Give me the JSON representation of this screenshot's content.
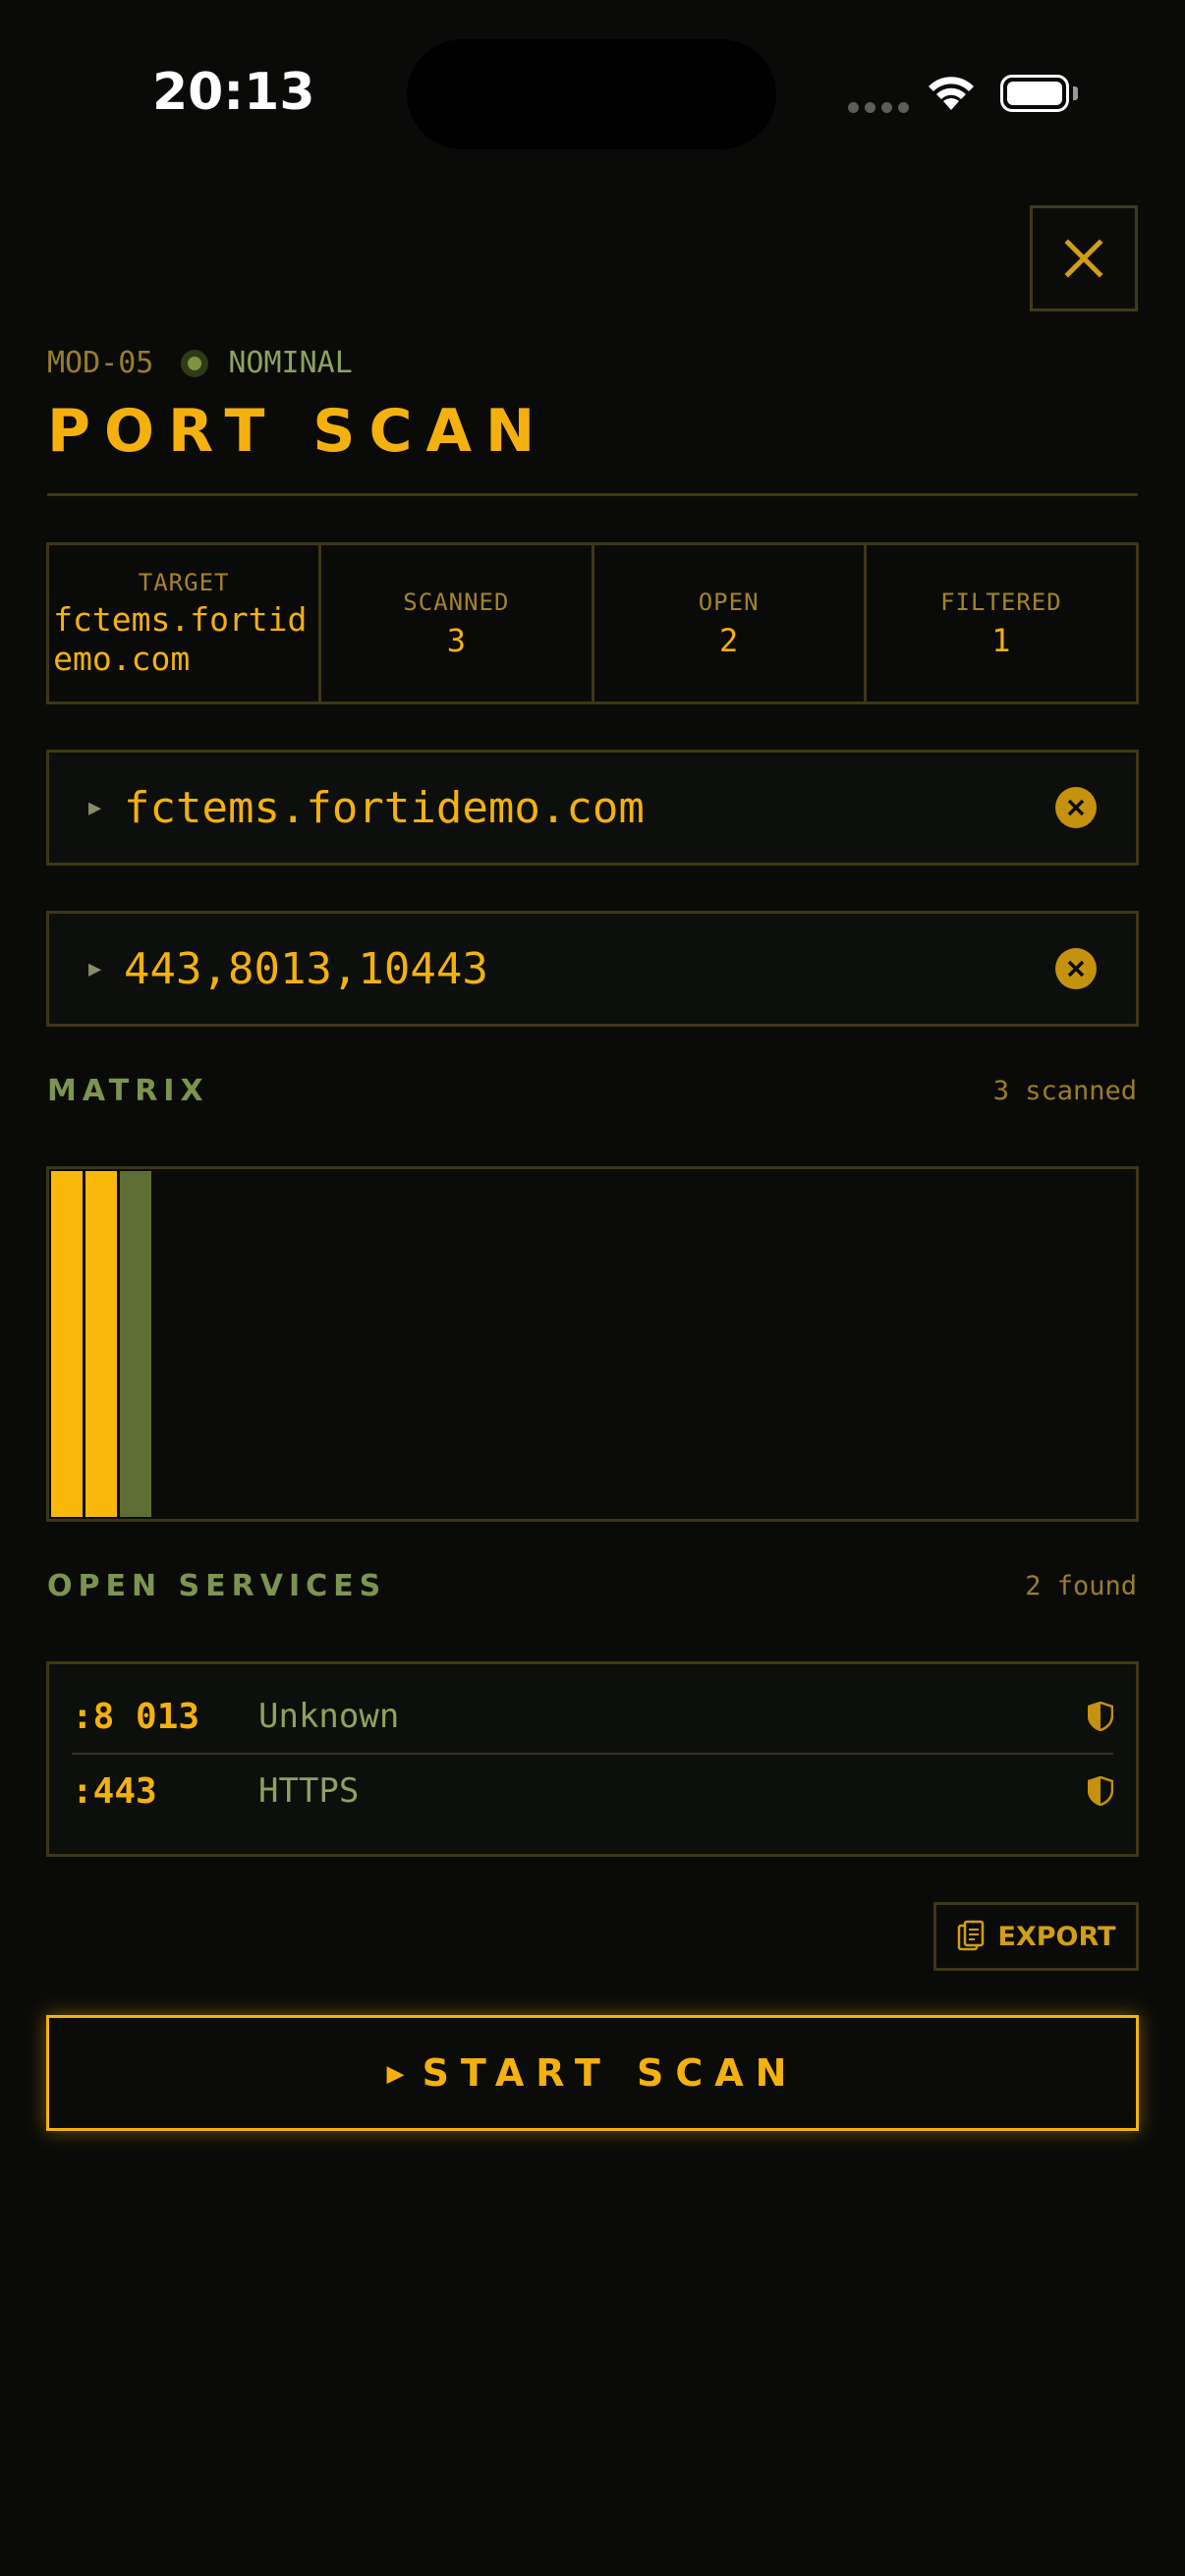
{
  "status_bar": {
    "time": "20:13"
  },
  "header": {
    "module_id": "MOD-05",
    "status": "NOMINAL",
    "title": "PORT SCAN"
  },
  "stats": [
    {
      "label": "TARGET",
      "value": "fctems.fortidemo.com"
    },
    {
      "label": "SCANNED",
      "value": "3"
    },
    {
      "label": "OPEN",
      "value": "2"
    },
    {
      "label": "FILTERED",
      "value": "1"
    }
  ],
  "inputs": {
    "host": {
      "value": "fctems.fortidemo.com"
    },
    "ports": {
      "value": "443,8013,10443"
    }
  },
  "matrix": {
    "title": "MATRIX",
    "count": "3 scanned",
    "cells": [
      {
        "state": "open",
        "color": "#f9b70a"
      },
      {
        "state": "open",
        "color": "#f9b70a"
      },
      {
        "state": "filtered",
        "color": "#5e6e34"
      }
    ]
  },
  "services": {
    "title": "OPEN SERVICES",
    "count": "2 found",
    "rows": [
      {
        "port": ":8 013",
        "name": "Unknown",
        "icon": "shield-icon"
      },
      {
        "port": ":443",
        "name": "HTTPS",
        "icon": "shield-icon"
      }
    ]
  },
  "actions": {
    "export_label": "EXPORT",
    "start_label": "START SCAN"
  },
  "colors": {
    "accent": "#f4b10e",
    "muted_green": "#7d9450",
    "border": "#3d3718",
    "background": "#0a0b09"
  }
}
